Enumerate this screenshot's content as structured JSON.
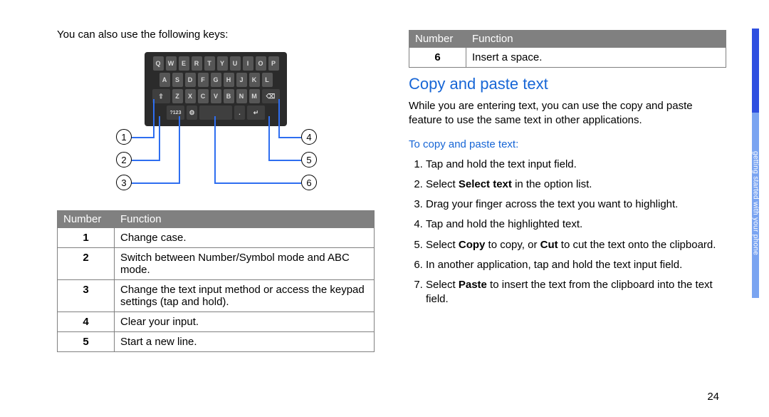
{
  "page_number": "24",
  "side_tab_label": "getting started with your phone",
  "left": {
    "intro": "You can also use the following keys:",
    "keyboard": {
      "row1": [
        "Q",
        "W",
        "E",
        "R",
        "T",
        "Y",
        "U",
        "I",
        "O",
        "P"
      ],
      "row2": [
        "A",
        "S",
        "D",
        "F",
        "G",
        "H",
        "J",
        "K",
        "L"
      ],
      "row3_shift": "⇧",
      "row3": [
        "Z",
        "X",
        "C",
        "V",
        "B",
        "N",
        "M"
      ],
      "row3_del": "⌫",
      "row4_mode": "?123",
      "row4_globe": "⚙",
      "row4_space": " ",
      "row4_period": ".",
      "row4_return": "↵"
    },
    "callouts": {
      "c1": "1",
      "c2": "2",
      "c3": "3",
      "c4": "4",
      "c5": "5",
      "c6": "6"
    },
    "table": {
      "h_num": "Number",
      "h_fn": "Function",
      "rows": [
        {
          "n": "1",
          "f": "Change case."
        },
        {
          "n": "2",
          "f": "Switch between Number/Symbol mode and ABC mode."
        },
        {
          "n": "3",
          "f": "Change the text input method or access the keypad settings (tap and hold)."
        },
        {
          "n": "4",
          "f": "Clear your input."
        },
        {
          "n": "5",
          "f": "Start a new line."
        }
      ]
    }
  },
  "right": {
    "table": {
      "h_num": "Number",
      "h_fn": "Function",
      "rows": [
        {
          "n": "6",
          "f": "Insert a space."
        }
      ]
    },
    "h2": "Copy and paste text",
    "para": "While you are entering text, you can use the copy and paste feature to use the same text in other applications.",
    "h3": "To copy and paste text:",
    "steps": {
      "s1": "Tap and hold the text input field.",
      "s2a": "Select ",
      "s2b": "Select text",
      "s2c": " in the option list.",
      "s3": "Drag your finger across the text you want to highlight.",
      "s4": "Tap and hold the highlighted text.",
      "s5a": "Select ",
      "s5b": "Copy",
      "s5c": " to copy, or ",
      "s5d": "Cut",
      "s5e": " to cut the text onto the clipboard.",
      "s6": "In another application, tap and hold the text input field.",
      "s7a": "Select ",
      "s7b": "Paste",
      "s7c": " to insert the text from the clipboard into the text field."
    }
  }
}
